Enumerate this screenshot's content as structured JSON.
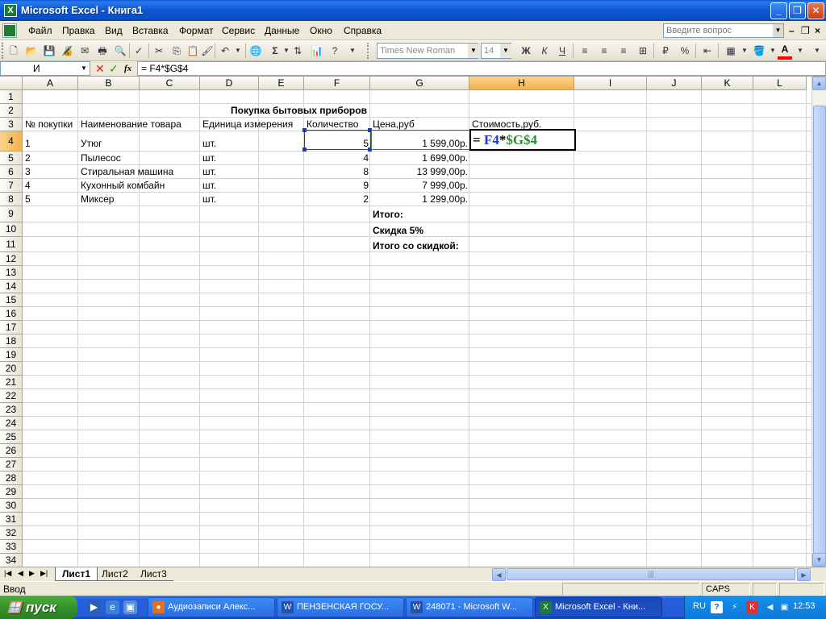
{
  "window": {
    "title": "Microsoft Excel - Книга1",
    "minimize_icon": "minimize-icon",
    "maximize_icon": "restore-icon",
    "close_icon": "close-icon"
  },
  "menu": {
    "items": [
      "Файл",
      "Правка",
      "Вид",
      "Вставка",
      "Формат",
      "Сервис",
      "Данные",
      "Окно",
      "Справка"
    ],
    "ask_placeholder": "Введите вопрос"
  },
  "toolbar": {
    "font_name": "Times New Roman",
    "font_size": "14",
    "bold": "Ж",
    "italic": "К",
    "underline": "Ч",
    "sum": "Σ",
    "percent": "%",
    "font_color_letter": "A",
    "colors": {
      "fill": "#ffff00",
      "font": "#ff0000"
    }
  },
  "formula_bar": {
    "name_box": "И",
    "fx": "fx",
    "formula": "= F4*$G$4"
  },
  "columns": [
    "A",
    "B",
    "C",
    "D",
    "E",
    "F",
    "G",
    "H",
    "I",
    "J",
    "K",
    "L"
  ],
  "rows": [
    "1",
    "2",
    "3",
    "4",
    "5",
    "6",
    "7",
    "8",
    "9",
    "10",
    "11",
    "12",
    "13",
    "14",
    "15",
    "16",
    "17",
    "18",
    "19",
    "20",
    "21",
    "22",
    "23",
    "24",
    "25",
    "26",
    "27",
    "28",
    "29",
    "30",
    "31",
    "32",
    "33",
    "34"
  ],
  "sheet": {
    "title": "Покупка бытовых приборов",
    "headers": {
      "number": "№ покупки",
      "name": "Наименование товара",
      "unit": "Единица измерения",
      "qty": "Количество",
      "price": "Цена,руб",
      "cost": "Стоимость,руб."
    },
    "items": [
      {
        "n": "1",
        "name": "Утюг",
        "unit": "шт.",
        "qty": "5",
        "price": "1 599,00р."
      },
      {
        "n": "2",
        "name": "Пылесос",
        "unit": "шт.",
        "qty": "4",
        "price": "1 699,00р."
      },
      {
        "n": "3",
        "name": "Стиральная машина",
        "unit": "шт.",
        "qty": "8",
        "price": "13 999,00р."
      },
      {
        "n": "4",
        "name": "Кухонный комбайн",
        "unit": "шт.",
        "qty": "9",
        "price": "7 999,00р."
      },
      {
        "n": "5",
        "name": "Миксер",
        "unit": "шт.",
        "qty": "2",
        "price": "1 299,00р."
      }
    ],
    "total": "Итого:",
    "discount": "Скидка 5%",
    "total_discount": "Итого со скидкой:",
    "edit": {
      "prefix": "= ",
      "ref1": "F4",
      "op": "*",
      "ref2": "$G$4"
    }
  },
  "sheet_tabs": [
    "Лист1",
    "Лист2",
    "Лист3"
  ],
  "status": {
    "mode": "Ввод",
    "caps": "CAPS"
  },
  "taskbar": {
    "start": "пуск",
    "tasks": [
      "Аудиозаписи Алекс...",
      "ПЕНЗЕНСКАЯ ГОСУ...",
      "248071 - Microsoft W...",
      "Microsoft Excel - Кни..."
    ],
    "lang": "RU",
    "clock": "12:53"
  }
}
